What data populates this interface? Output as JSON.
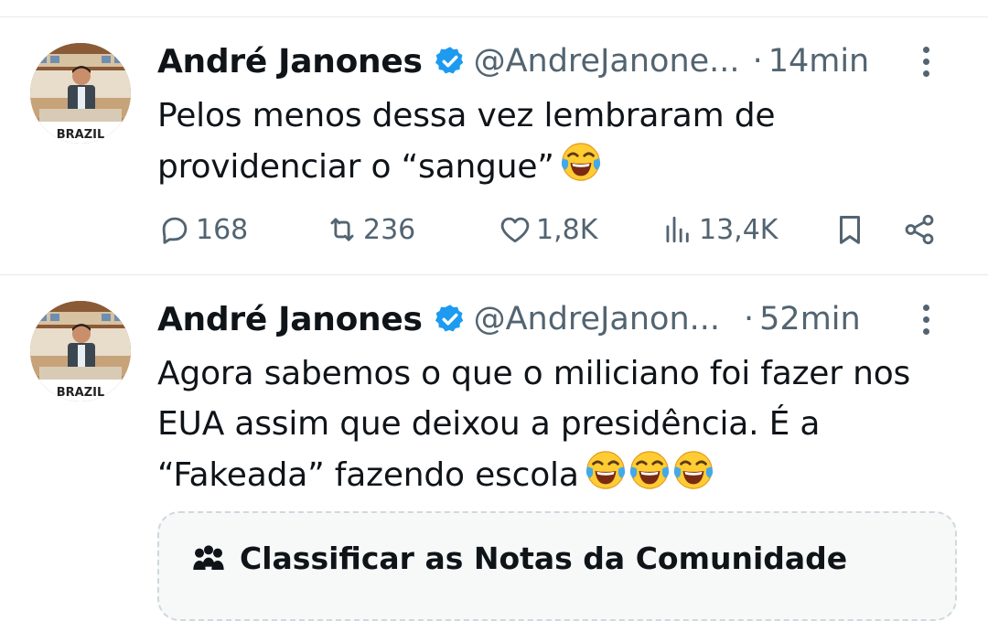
{
  "tweets": [
    {
      "author_name": "André Janones",
      "handle": "@AndreJanone...",
      "separator": "·",
      "time": "14min",
      "text_line1": "Pelos menos dessa vez lembraram de",
      "text_line2": "providenciar o “sangue”",
      "emoji": "face-with-tears-of-joy",
      "emoji_count": 1,
      "stats": {
        "replies": "168",
        "reposts": "236",
        "likes": "1,8K",
        "views": "13,4K"
      },
      "avatar_caption": "BRAZIL"
    },
    {
      "author_name": "André Janones",
      "handle": "@AndreJanon...",
      "separator": "·",
      "time": "52min",
      "text_line1": "Agora sabemos o que o miliciano foi fazer nos",
      "text_line2": "EUA assim que deixou a presidência. É a",
      "text_line3": "“Fakeada” fazendo escola",
      "emoji": "face-with-tears-of-joy",
      "emoji_count": 3,
      "avatar_caption": "BRAZIL",
      "community_note": "Classificar as Notas da Comunidade"
    }
  ],
  "colors": {
    "text_primary": "#0f1419",
    "text_secondary": "#536471",
    "verified_blue": "#1d9bf0",
    "divider": "#e6e9ec"
  },
  "icons": [
    "verified-badge-icon",
    "more-options-icon",
    "reply-icon",
    "repost-icon",
    "like-icon",
    "views-icon",
    "bookmark-icon",
    "share-icon",
    "community-notes-icon"
  ]
}
